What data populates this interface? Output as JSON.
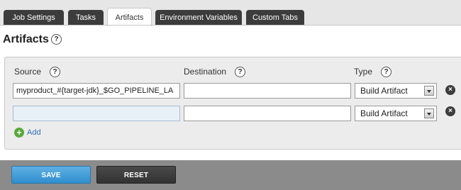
{
  "tabs": [
    {
      "label": "Job Settings",
      "active": false
    },
    {
      "label": "Tasks",
      "active": false
    },
    {
      "label": "Artifacts",
      "active": true
    },
    {
      "label": "Environment Variables",
      "active": false
    },
    {
      "label": "Custom Tabs",
      "active": false
    }
  ],
  "page": {
    "title": "Artifacts",
    "help": "?"
  },
  "columns": {
    "source": "Source",
    "destination": "Destination",
    "type": "Type"
  },
  "rows": [
    {
      "source": "myproduct_#{target-jdk}_$GO_PIPELINE_LA",
      "destination": "",
      "type": "Build Artifact"
    },
    {
      "source": "",
      "destination": "",
      "type": "Build Artifact"
    }
  ],
  "add_label": "Add",
  "icons": {
    "help": "question-icon",
    "add": "plus-circle-icon",
    "remove": "close-circle-icon",
    "select": "chevron-down-icon"
  },
  "buttons": {
    "save": "SAVE",
    "reset": "RESET"
  },
  "colors": {
    "save": "#2f8fce",
    "reset": "#333333",
    "tab_dark": "#3c3c3c",
    "add_link": "#2f6fb7"
  }
}
